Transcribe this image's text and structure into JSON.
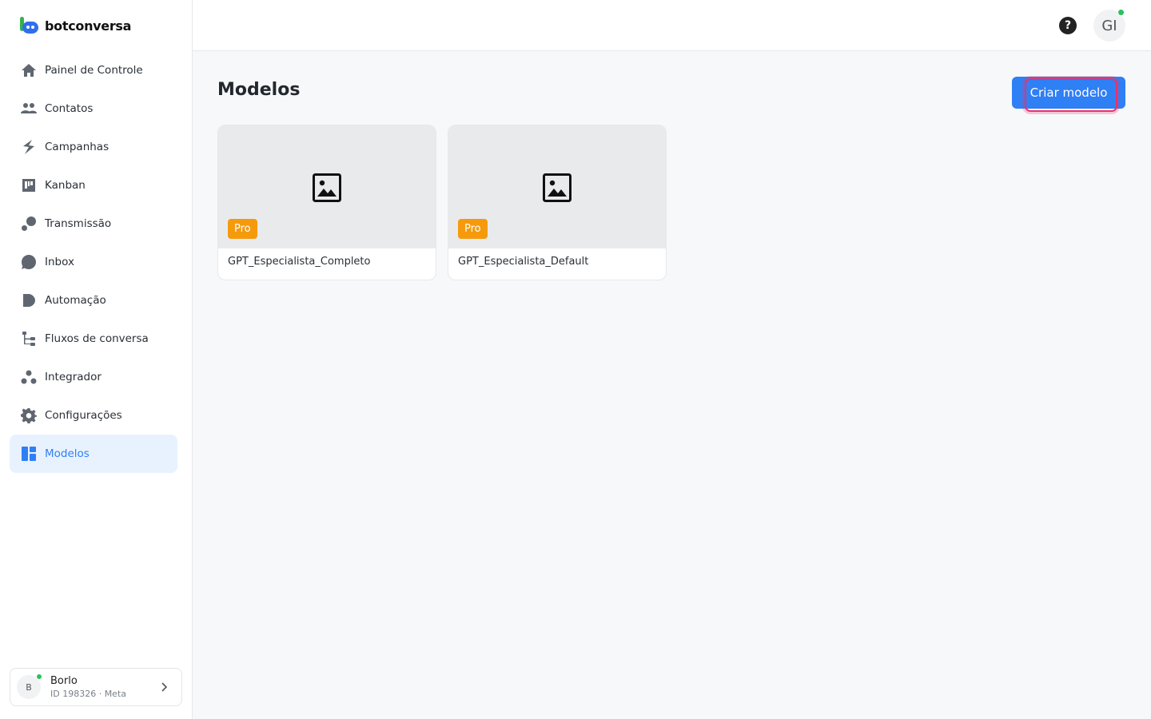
{
  "brand": {
    "name": "botconversa"
  },
  "sidebar": {
    "items": [
      {
        "label": "Painel de Controle",
        "icon": "home-icon"
      },
      {
        "label": "Contatos",
        "icon": "contacts-icon"
      },
      {
        "label": "Campanhas",
        "icon": "campaigns-icon"
      },
      {
        "label": "Kanban",
        "icon": "kanban-icon"
      },
      {
        "label": "Transmissão",
        "icon": "broadcast-icon"
      },
      {
        "label": "Inbox",
        "icon": "chat-bubble-icon"
      },
      {
        "label": "Automação",
        "icon": "automation-icon"
      },
      {
        "label": "Fluxos de conversa",
        "icon": "flows-icon"
      },
      {
        "label": "Integrador",
        "icon": "integrator-icon"
      },
      {
        "label": "Configurações",
        "icon": "gear-icon"
      },
      {
        "label": "Modelos",
        "icon": "templates-icon",
        "active": true
      }
    ],
    "account": {
      "initial": "B",
      "name": "Borlo",
      "sub": "ID 198326 · Meta",
      "status_color": "#2bc15b"
    }
  },
  "header": {
    "help_glyph": "?",
    "user_initials": "GI",
    "status_color": "#2bc15b"
  },
  "main": {
    "title": "Modelos",
    "create_button": "Criar modelo",
    "cards": [
      {
        "badge": "Pro",
        "name": "GPT_Especialista_Completo"
      },
      {
        "badge": "Pro",
        "name": "GPT_Especialista_Default"
      }
    ]
  },
  "colors": {
    "accent": "#2f7ff5",
    "badge": "#f59a0c",
    "focus": "#e8336a"
  }
}
